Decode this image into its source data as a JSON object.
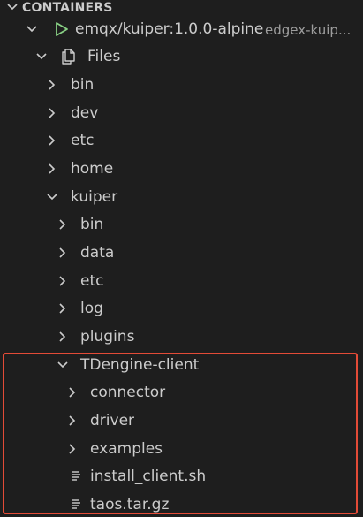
{
  "section": {
    "title": "CONTAINERS"
  },
  "container": {
    "name": "emqx/kuiper:1.0.0-alpine",
    "description": "edgex-kuip...",
    "status_color": "#89d185"
  },
  "files_node": {
    "label": "Files"
  },
  "root_folders": [
    {
      "label": "bin"
    },
    {
      "label": "dev"
    },
    {
      "label": "etc"
    },
    {
      "label": "home"
    }
  ],
  "kuiper_folder": {
    "label": "kuiper"
  },
  "kuiper_children": [
    {
      "label": "bin"
    },
    {
      "label": "data"
    },
    {
      "label": "etc"
    },
    {
      "label": "log"
    },
    {
      "label": "plugins"
    }
  ],
  "tdengine_folder": {
    "label": "TDengine-client"
  },
  "tdengine_children_folders": [
    {
      "label": "connector"
    },
    {
      "label": "driver"
    },
    {
      "label": "examples"
    }
  ],
  "tdengine_files": [
    {
      "label": "install_client.sh"
    },
    {
      "label": "taos.tar.gz"
    }
  ],
  "colors": {
    "background": "#1e1e1e",
    "text": "#cccccc",
    "description": "#9d9d9d",
    "highlight_border": "#e34b37"
  }
}
